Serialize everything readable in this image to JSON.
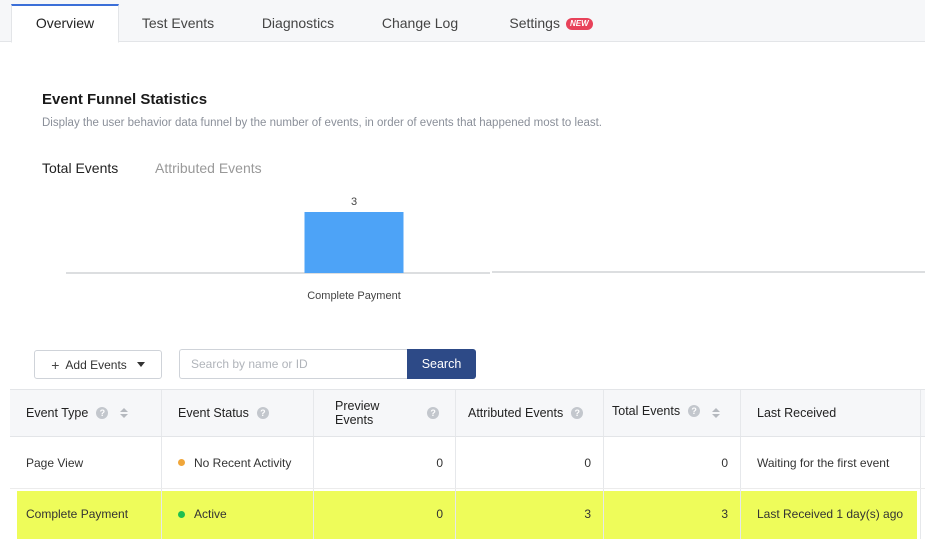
{
  "tabs": [
    {
      "label": "Overview",
      "active": true
    },
    {
      "label": "Test Events"
    },
    {
      "label": "Diagnostics"
    },
    {
      "label": "Change Log"
    },
    {
      "label": "Settings",
      "badge": "NEW"
    }
  ],
  "header": {
    "title": "Event Funnel Statistics",
    "subtitle": "Display the user behavior data funnel by the number of events, in order of events that happened most to least."
  },
  "subtabs": [
    {
      "label": "Total Events",
      "active": true
    },
    {
      "label": "Attributed Events"
    }
  ],
  "chart_data": {
    "type": "bar",
    "categories": [
      "Complete Payment"
    ],
    "values": [
      3
    ],
    "ylim": [
      0,
      3
    ],
    "bar_color": "#4da3f7"
  },
  "toolbar": {
    "add_events_label": "Add Events",
    "search_placeholder": "Search by name or ID",
    "search_button": "Search"
  },
  "table": {
    "columns": [
      "Event Type",
      "Event Status",
      "Preview Events",
      "Attributed Events",
      "Total Events",
      "Last Received"
    ],
    "rows": [
      {
        "event_type": "Page View",
        "status": "No Recent Activity",
        "status_color": "#f0a63a",
        "preview": "0",
        "attributed": "0",
        "total": "0",
        "last_received": "Waiting for the first event"
      },
      {
        "event_type": "Complete Payment",
        "status": "Active",
        "status_color": "#1fbf4f",
        "preview": "0",
        "attributed": "3",
        "total": "3",
        "last_received": "Last Received 1 day(s) ago"
      }
    ]
  },
  "colors": {
    "accent": "#3b6fd8",
    "search_button": "#2d4a87",
    "highlight": "#eefc5a"
  }
}
